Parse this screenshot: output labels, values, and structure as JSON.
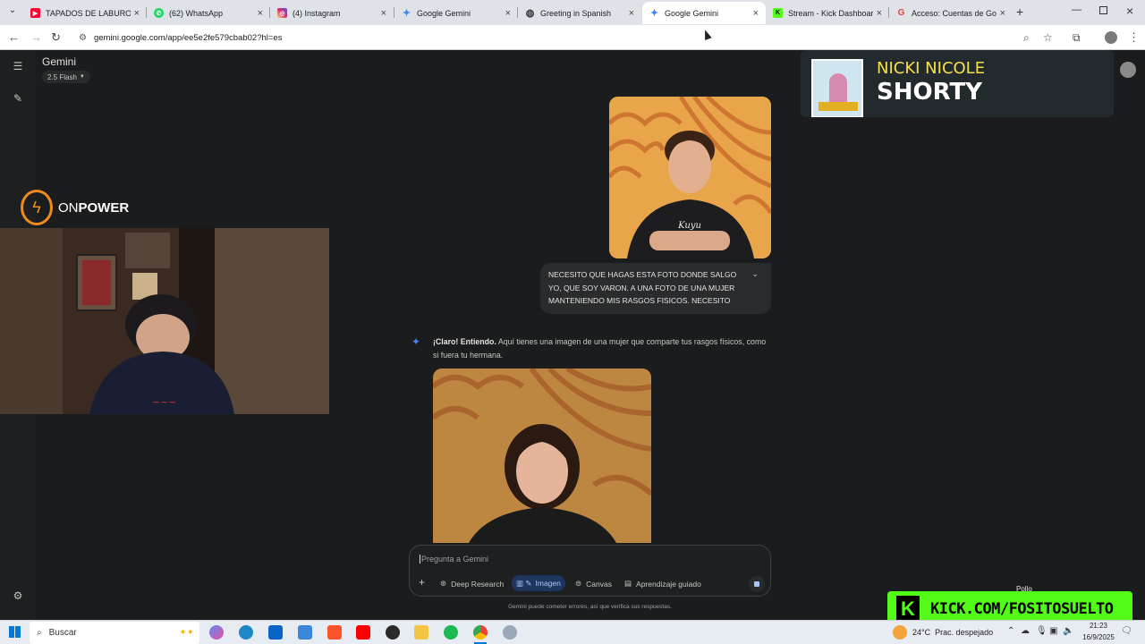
{
  "tabs": [
    {
      "title": "TAPADOS DE LABURO",
      "color": "#ff0033",
      "glyph": "▶"
    },
    {
      "title": "(62) WhatsApp",
      "color": "#25d366",
      "glyph": "✆"
    },
    {
      "title": "(4) Instagram",
      "color": "#d6249f",
      "glyph": "◎"
    },
    {
      "title": "Google Gemini",
      "color": "#4285f4",
      "glyph": "✦"
    },
    {
      "title": "Greeting in Spanish",
      "color": "#444444",
      "glyph": "◍"
    },
    {
      "title": "Google Gemini",
      "color": "#4285f4",
      "glyph": "✦"
    },
    {
      "title": "Stream - Kick Dashboard",
      "color": "#53fc18",
      "glyph": "K"
    },
    {
      "title": "Acceso: Cuentas de Google",
      "color": "#ea4335",
      "glyph": "G"
    }
  ],
  "browser": {
    "url": "gemini.google.com/app/ee5e2fe579cbab02?hl=es"
  },
  "gemini": {
    "title": "Gemini",
    "model": "2.5 Flash",
    "user_message": "NECESITO QUE HAGAS ESTA FOTO DONDE SALGO YO, QUE SOY VARON. A UNA FOTO DE UNA MUJER MANTENIENDO MIS RASGOS FISICOS. NECESITO QUE...",
    "response_bold": "¡Claro! Entiendo.",
    "response_text": " Aquí tienes una imagen de una mujer que comparte tus rasgos físicos, como si fuera tu hermana.",
    "input_placeholder": "Pregunta a Gemini",
    "tools": [
      "Deep Research",
      "Imagen",
      "Canvas",
      "Aprendizaje guiado"
    ],
    "disclaimer": "Gemini puede cometer errores, así que verifica sus respuestas.",
    "shirt_text": "Kuyu"
  },
  "overlay": {
    "brand_on": "ON",
    "brand_power": "POWER",
    "song_artist": "NICKI NICOLE",
    "song_title": "SHORTY",
    "kick_text": "KICK.COM/FOSITOSUELTO",
    "kick_letter": "K",
    "partial_label": "Pollo"
  },
  "taskbar": {
    "search_label": "Buscar",
    "weather": "24°C  Prac. despejado",
    "time": "21:23",
    "date": "16/9/2025"
  },
  "colors": {
    "kick_green": "#53fc18",
    "gemini_blue": "#4285f4",
    "artist_yellow": "#f4e04d"
  }
}
